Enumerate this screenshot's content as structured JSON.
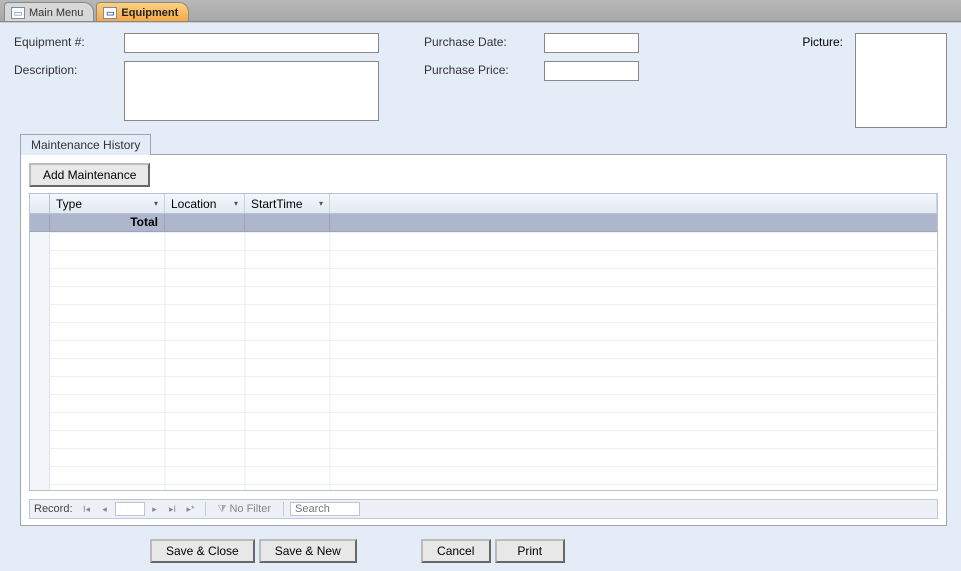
{
  "tabs": {
    "main_menu": "Main Menu",
    "equipment": "Equipment"
  },
  "form": {
    "equipment_num_label": "Equipment #:",
    "description_label": "Description:",
    "purchase_date_label": "Purchase Date:",
    "purchase_price_label": "Purchase Price:",
    "picture_label": "Picture:",
    "equipment_num_value": "",
    "description_value": "",
    "purchase_date_value": "",
    "purchase_price_value": ""
  },
  "subtab": {
    "title": "Maintenance History",
    "add_button": "Add Maintenance",
    "columns": {
      "type": "Type",
      "location": "Location",
      "starttime": "StartTime"
    },
    "total_label": "Total"
  },
  "recnav": {
    "label": "Record:",
    "nofilter": "No Filter",
    "search": "Search"
  },
  "buttons": {
    "save_close": "Save & Close",
    "save_new": "Save & New",
    "cancel": "Cancel",
    "print": "Print"
  }
}
